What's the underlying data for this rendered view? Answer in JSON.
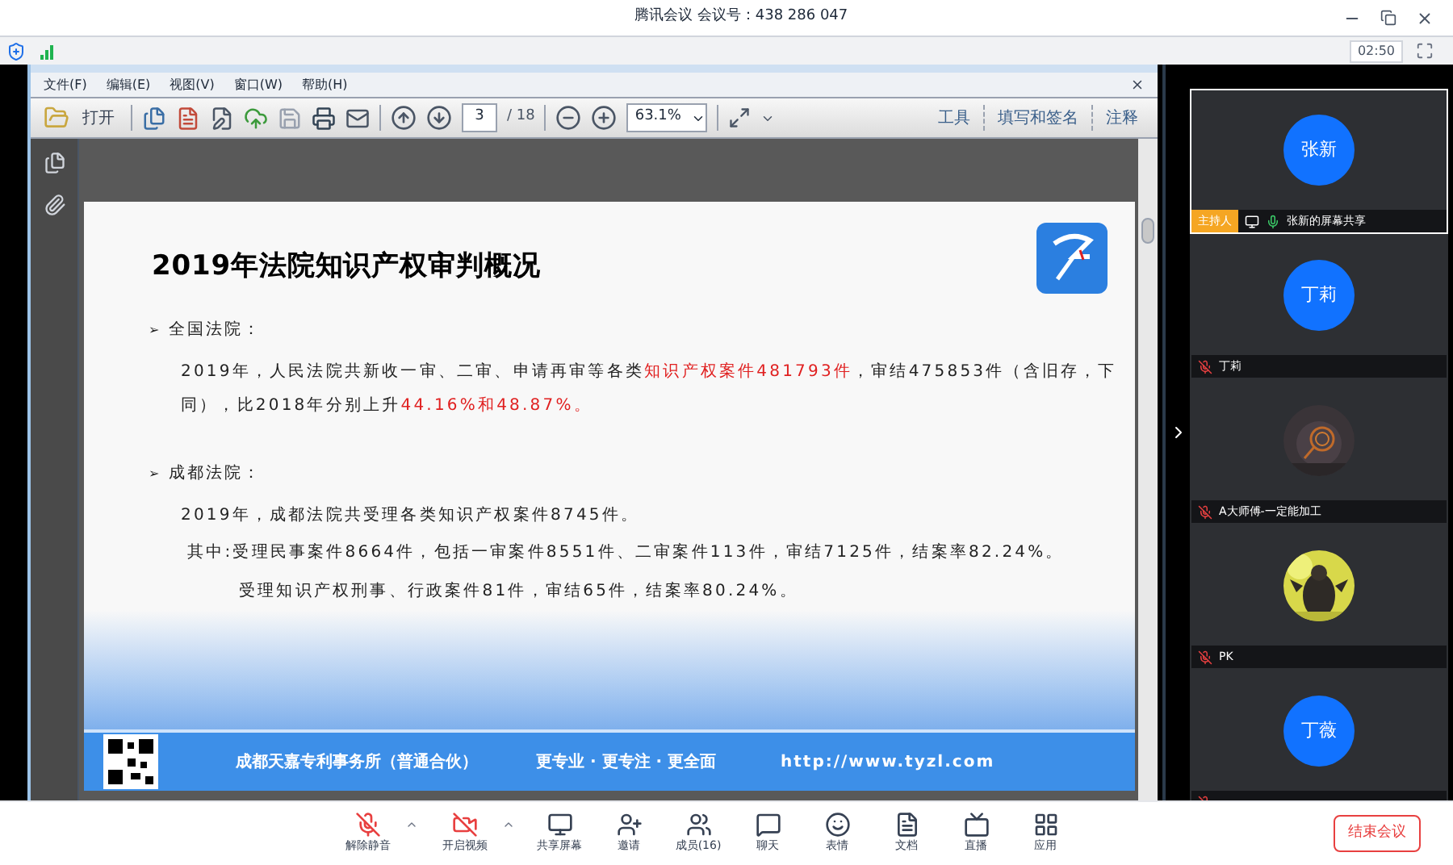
{
  "window": {
    "title": "腾讯会议 会议号：438 286 047",
    "timer": "02:50"
  },
  "pdf_viewer": {
    "menu": [
      "文件(F)",
      "编辑(E)",
      "视图(V)",
      "窗口(W)",
      "帮助(H)"
    ],
    "toolbar": {
      "open_label": "打开",
      "page": "3",
      "page_total": "/ 18",
      "zoom": "63.1%",
      "right_tabs": [
        "工具",
        "填写和签名",
        "注释"
      ]
    },
    "page": {
      "title": "2019年法院知识产权审判概况",
      "bullet": "➢",
      "sections": [
        {
          "heading": "全国法院：",
          "paragraphs": [
            {
              "kind": "body",
              "segments": [
                {
                  "text": "2019年，人民法院共新收一审、二审、申请再审等各类",
                  "highlight": false
                },
                {
                  "text": "知识产权案件481793件",
                  "highlight": true
                },
                {
                  "text": "，审结475853件（含旧存，下同），比2018年分别上升",
                  "highlight": false
                },
                {
                  "text": "44.16%和48.87%。",
                  "highlight": true
                }
              ]
            }
          ]
        },
        {
          "heading": "成都法院：",
          "paragraphs": [
            {
              "kind": "body",
              "segments": [
                {
                  "text": "2019年，成都法院共受理各类知识产权案件8745件。",
                  "highlight": false
                }
              ]
            },
            {
              "kind": "sub",
              "segments": [
                {
                  "text": "其中:受理民事案件8664件，包括一审案件8551件、二审案件113件，审结7125件，结案率82.24%。",
                  "highlight": false
                }
              ]
            },
            {
              "kind": "indent",
              "segments": [
                {
                  "text": "受理知识产权刑事、行政案件81件，审结65件，结案率80.24%。",
                  "highlight": false
                }
              ]
            }
          ]
        }
      ],
      "footer": [
        "成都天嘉专利事务所（普通合伙）",
        "更专业 · 更专注 · 更全面",
        "http://www.tyzl.com"
      ]
    }
  },
  "participants": [
    {
      "avatar": {
        "kind": "initials",
        "text": "张新"
      },
      "name": "张新的屏幕共享",
      "host_badge": "主持人",
      "host": true,
      "muted": false,
      "selected": true
    },
    {
      "avatar": {
        "kind": "initials",
        "text": "丁莉"
      },
      "name": "丁莉",
      "host": false,
      "muted": true,
      "selected": false
    },
    {
      "name": "A大师傅-一定能加工",
      "host": false,
      "muted": true,
      "selected": false
    },
    {
      "name": "PK",
      "host": false,
      "muted": true,
      "selected": false
    },
    {
      "avatar": {
        "kind": "initials",
        "text": "丁薇"
      },
      "host": false,
      "muted": true,
      "selected": false
    }
  ],
  "controls": {
    "media": [
      {
        "kind": "mic",
        "label": "解除静音",
        "on": false
      },
      {
        "kind": "camera",
        "label": "开启视频",
        "on": false
      }
    ],
    "tools": [
      {
        "kind": "share",
        "label": "共享屏幕"
      },
      {
        "kind": "invite",
        "label": "邀请"
      },
      {
        "kind": "members",
        "label": "成员(16)"
      },
      {
        "kind": "chat",
        "label": "聊天"
      },
      {
        "kind": "emoji",
        "label": "表情"
      },
      {
        "kind": "doc",
        "label": "文档"
      },
      {
        "kind": "live",
        "label": "直播"
      },
      {
        "kind": "apps",
        "label": "应用"
      }
    ],
    "end_button": "结束会议"
  }
}
